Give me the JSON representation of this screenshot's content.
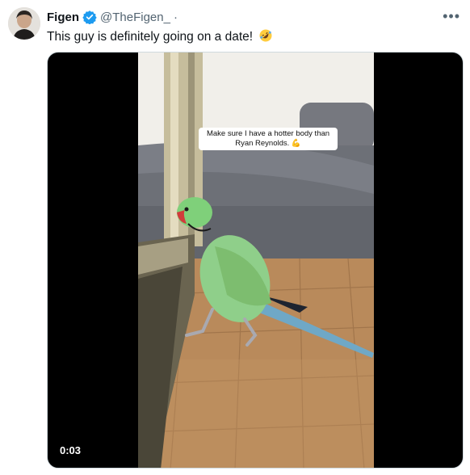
{
  "tweet": {
    "author_name": "Figen",
    "author_handle": "@TheFigen_",
    "separator": "·",
    "verified_icon": "verified-badge-icon",
    "more_icon": "more-options-icon",
    "text": "This guy is definitely going on a date!",
    "emoji_icon": "rolling-on-floor-laughing-emoji"
  },
  "video": {
    "caption_line1": "Make sure I have a hotter body than",
    "caption_line2": "Ryan Reynolds.",
    "caption_emoji_icon": "flexed-biceps-emoji",
    "timestamp": "0:03"
  },
  "colors": {
    "verified": "#1d9bf0",
    "secondary_text": "#536471",
    "parrot_green": "#8fd08a",
    "floor": "#b98c5e",
    "sofa": "#6e7179"
  }
}
